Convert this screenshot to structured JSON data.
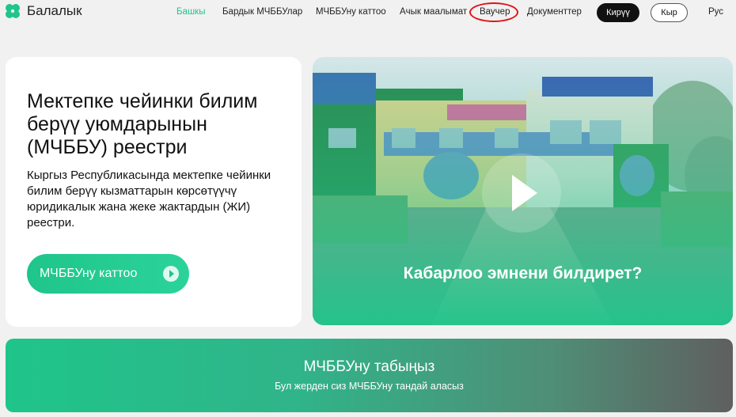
{
  "header": {
    "logo_text": "Балалык",
    "nav": [
      {
        "label": "Башкы",
        "active": true
      },
      {
        "label": "Бардык МЧББУлар"
      },
      {
        "label": "МЧББУну каттоо"
      },
      {
        "label": "Ачык маалымат"
      },
      {
        "label": "Ваучер",
        "highlighted": true
      },
      {
        "label": "Документтер"
      }
    ],
    "login_label": "Кирүү",
    "lang_current": "Кыр",
    "lang_alt": "Рус"
  },
  "hero": {
    "title": "Мектепке чейинки билим берүү уюмдарынын (МЧББУ) реестри",
    "description": "Кыргыз Республикасында мектепке чейинки билим берүү кызматтарын көрсөтүүчү юридикалык жана жеке жактардын (ЖИ) реестри.",
    "register_button": "МЧББУну каттоо"
  },
  "video": {
    "caption": "Кабарлоо эмнени билдирет?"
  },
  "banner": {
    "title": "МЧББУну табыңыз",
    "subtitle": "Бул жерден сиз МЧББУну тандай аласыз"
  },
  "colors": {
    "accent": "#1fc58b",
    "highlight_ring": "#e0141c",
    "dark": "#111111"
  },
  "icons": {
    "logo": "clover-logo-icon",
    "register_arrow": "play-arrow-icon",
    "video_play": "play-icon"
  }
}
